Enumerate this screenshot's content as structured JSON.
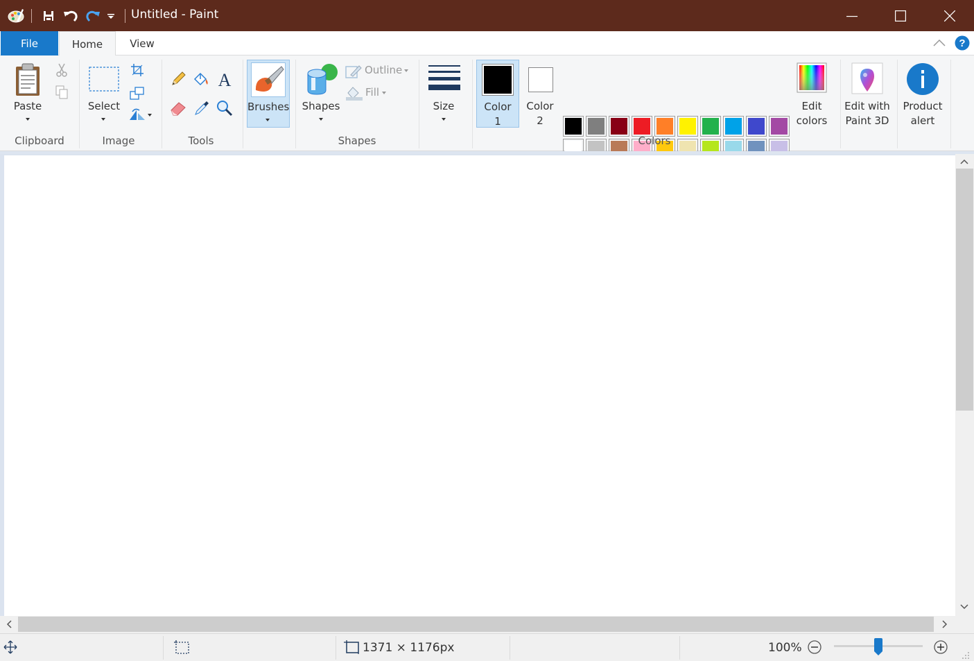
{
  "window": {
    "title": "Untitled - Paint",
    "controls": [
      "minimize",
      "maximize",
      "close"
    ]
  },
  "quick_access": [
    "paint-logo-icon",
    "save-icon",
    "undo-icon",
    "redo-icon",
    "customize-quick-access-icon"
  ],
  "tabs": {
    "file": "File",
    "home": "Home",
    "view": "View",
    "active": "Home"
  },
  "ribbon": {
    "clipboard": {
      "paste": "Paste",
      "group": "Clipboard"
    },
    "image": {
      "select": "Select",
      "group": "Image"
    },
    "tools": {
      "group": "Tools"
    },
    "brushes": {
      "label": "Brushes"
    },
    "shapes": {
      "shapes": "Shapes",
      "outline": "Outline",
      "fill": "Fill",
      "group": "Shapes"
    },
    "size": {
      "label": "Size"
    },
    "colors": {
      "color1_line1": "Color",
      "color1_line2": "1",
      "color2_line1": "Color",
      "color2_line2": "2",
      "group": "Colors",
      "color1_value": "#000000",
      "color2_value": "#ffffff",
      "palette_row1": [
        "#000000",
        "#7f7f7f",
        "#880015",
        "#ed1c24",
        "#ff7f27",
        "#fff200",
        "#22b14c",
        "#00a2e8",
        "#3f48cc",
        "#a349a4"
      ],
      "palette_row2": [
        "#ffffff",
        "#c3c3c3",
        "#b97a57",
        "#ffaec9",
        "#ffc90e",
        "#efe4b0",
        "#b5e61d",
        "#99d9ea",
        "#7092be",
        "#c8bfe7"
      ],
      "edit_line1": "Edit",
      "edit_line2": "colors"
    },
    "paint3d": {
      "line1": "Edit with",
      "line2": "Paint 3D"
    },
    "product_alert": {
      "line1": "Product",
      "line2": "alert"
    }
  },
  "statusbar": {
    "canvas_size": "1371 × 1176px",
    "zoom": "100%",
    "zoom_level_percent": 100
  },
  "colors": {
    "titlebar": "#5d2a1c",
    "file_tab": "#1979ca",
    "accent": "#0078d7",
    "selected_button": "#cce4f7"
  }
}
